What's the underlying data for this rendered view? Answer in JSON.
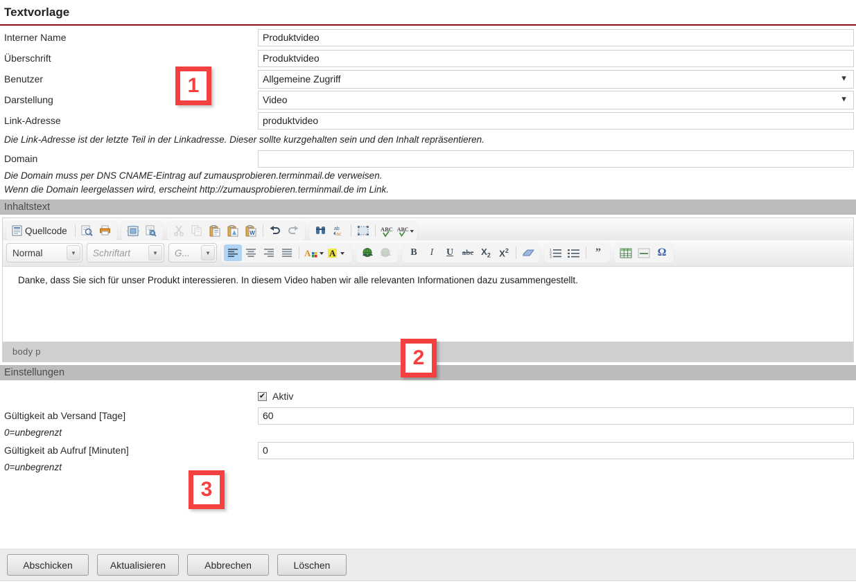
{
  "page": {
    "title": "Textvorlage",
    "accent": "#8c1111",
    "annotation_color": "#f4413f"
  },
  "form": {
    "rows": [
      {
        "label": "Interner Name",
        "value": "Produktvideo",
        "type": "text"
      },
      {
        "label": "Überschrift",
        "value": "Produktvideo",
        "type": "text"
      },
      {
        "label": "Benutzer",
        "value": "Allgemeine Zugriff",
        "type": "select"
      },
      {
        "label": "Darstellung",
        "value": "Video",
        "type": "select"
      },
      {
        "label": "Link-Adresse",
        "value": "produktvideo",
        "type": "text"
      }
    ],
    "link_hint": "Die Link-Adresse ist der letzte Teil in der Linkadresse. Dieser sollte kurzgehalten sein und den Inhalt repräsentieren.",
    "domain_label": "Domain",
    "domain_value": "",
    "domain_hint_1": "Die Domain muss per DNS CNAME-Eintrag auf zumausprobieren.terminmail.de verweisen.",
    "domain_hint_2": "Wenn die Domain leergelassen wird, erscheint http://zumausprobieren.terminmail.de im Link."
  },
  "sections": {
    "content_header": "Inhaltstext",
    "settings_header": "Einstellungen"
  },
  "editor": {
    "source_button": "Quellcode",
    "paragraph_format": "Normal",
    "font_family": "Schriftart",
    "font_size": "G...",
    "body_text": "Danke, dass Sie sich für unser Produkt interessieren. In diesem Video haben wir alle relevanten Informationen dazu zusammengestellt.",
    "status_path": "body   p",
    "icons_row1": [
      "source-code-icon",
      "preview-icon",
      "print-icon",
      "templates-icon",
      "document-properties-icon",
      "cut-icon",
      "copy-icon",
      "paste-icon",
      "paste-text-icon",
      "paste-word-icon",
      "undo-icon",
      "redo-icon",
      "find-icon",
      "replace-icon",
      "select-all-icon",
      "spellcheck-icon",
      "spellcheck-options-icon"
    ],
    "icons_row2": [
      "align-left-icon",
      "align-center-icon",
      "align-right-icon",
      "align-justify-icon",
      "text-color-icon",
      "background-color-icon",
      "link-icon",
      "unlink-icon",
      "bold-icon",
      "italic-icon",
      "underline-icon",
      "strikethrough-icon",
      "subscript-icon",
      "superscript-icon",
      "remove-format-icon",
      "numbered-list-icon",
      "bulleted-list-icon",
      "blockquote-icon",
      "table-icon",
      "horizontal-rule-icon",
      "special-char-icon"
    ]
  },
  "settings": {
    "active_label": "Aktiv",
    "active_checked": true,
    "validity_send_label": "Gültigkeit ab Versand [Tage]",
    "validity_send_value": "60",
    "validity_send_hint": "0=unbegrenzt",
    "validity_open_label": "Gültigkeit ab Aufruf [Minuten]",
    "validity_open_value": "0",
    "validity_open_hint": "0=unbegrenzt"
  },
  "buttons": [
    {
      "label": "Abschicken",
      "name": "submit-button"
    },
    {
      "label": "Aktualisieren",
      "name": "update-button"
    },
    {
      "label": "Abbrechen",
      "name": "cancel-button"
    },
    {
      "label": "Löschen",
      "name": "delete-button"
    }
  ],
  "annotations": [
    {
      "number": "1"
    },
    {
      "number": "2"
    },
    {
      "number": "3"
    }
  ]
}
